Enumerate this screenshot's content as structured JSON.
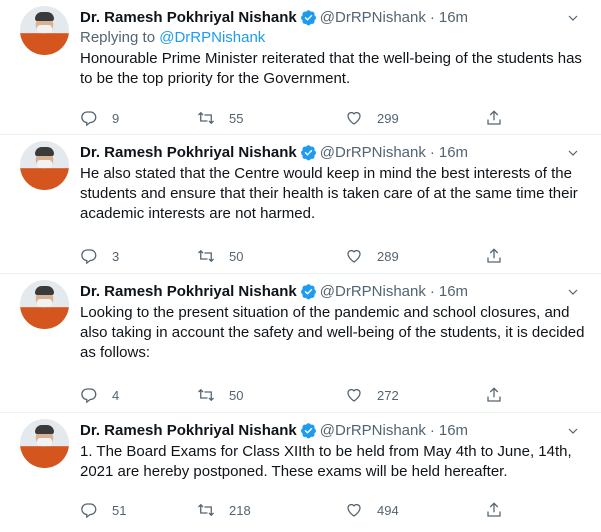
{
  "tweets": [
    {
      "name": "Dr. Ramesh Pokhriyal Nishank",
      "handle": "@DrRPNishank",
      "dot": "·",
      "time": "16m",
      "reply_prefix": "Replying to ",
      "reply_handle": "@DrRPNishank",
      "text": "Honourable Prime Minister reiterated that the well-being of the students has to be the top priority for the Government.",
      "replies": "9",
      "retweets": "55",
      "likes": "299"
    },
    {
      "name": "Dr. Ramesh Pokhriyal Nishank",
      "handle": "@DrRPNishank",
      "dot": "·",
      "time": "16m",
      "text": "He also stated that the Centre would keep in mind the best interests of the students and ensure that their health is taken care of at the same time their academic interests are not harmed.",
      "replies": "3",
      "retweets": "50",
      "likes": "289"
    },
    {
      "name": "Dr. Ramesh Pokhriyal Nishank",
      "handle": "@DrRPNishank",
      "dot": "·",
      "time": "16m",
      "text": "Looking to the present situation of the pandemic and school closures, and also taking in account the safety and well-being of the students, it is decided as follows:",
      "replies": "4",
      "retweets": "50",
      "likes": "272"
    },
    {
      "name": "Dr. Ramesh Pokhriyal Nishank",
      "handle": "@DrRPNishank",
      "dot": "·",
      "time": "16m",
      "text": "1.  The Board Exams for Class XIIth to be held from May 4th to June, 14th, 2021 are hereby postponed. These exams will be held hereafter.",
      "replies": "51",
      "retweets": "218",
      "likes": "494"
    }
  ],
  "icons": {
    "verified": "verified-badge-icon",
    "more": "more-options-icon",
    "reply": "reply-icon",
    "retweet": "retweet-icon",
    "like": "like-icon",
    "share": "share-icon"
  },
  "colors": {
    "accent": "#1d9bf0",
    "muted": "#536471",
    "text": "#0f1419"
  }
}
